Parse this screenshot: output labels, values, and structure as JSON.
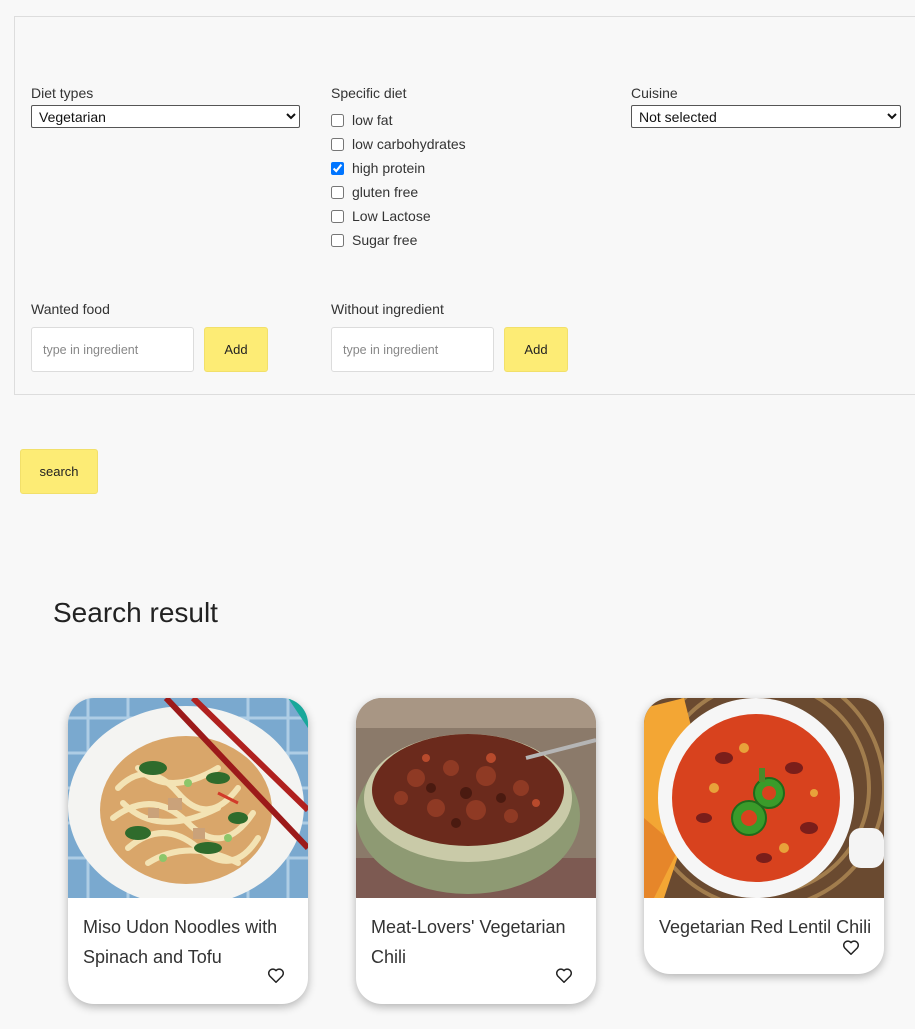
{
  "filters": {
    "diet_types": {
      "label": "Diet types",
      "selected": "Vegetarian"
    },
    "specific_diet": {
      "label": "Specific diet",
      "options": [
        {
          "label": "low fat",
          "checked": false
        },
        {
          "label": "low carbohydrates",
          "checked": false
        },
        {
          "label": "high protein",
          "checked": true
        },
        {
          "label": "gluten free",
          "checked": false
        },
        {
          "label": "Low Lactose",
          "checked": false
        },
        {
          "label": "Sugar free",
          "checked": false
        }
      ]
    },
    "cuisine": {
      "label": "Cuisine",
      "selected": "Not selected"
    },
    "wanted_food": {
      "label": "Wanted food",
      "placeholder": "type in ingredient",
      "button": "Add"
    },
    "without_ingredient": {
      "label": "Without ingredient",
      "placeholder": "type in ingredient",
      "button": "Add"
    }
  },
  "search_button": "search",
  "results": {
    "title": "Search result",
    "items": [
      {
        "title": "Miso Udon Noodles with Spinach and Tofu",
        "favorite_icon": "heart-outline-icon"
      },
      {
        "title": "Meat-Lovers' Vegetarian Chili",
        "favorite_icon": "heart-outline-icon"
      },
      {
        "title": "Vegetarian Red Lentil Chili",
        "favorite_icon": "heart-outline-icon"
      }
    ]
  },
  "colors": {
    "button_yellow": "#fdec75",
    "background": "#f8f8f8",
    "checkbox_accent": "#0075ff"
  }
}
